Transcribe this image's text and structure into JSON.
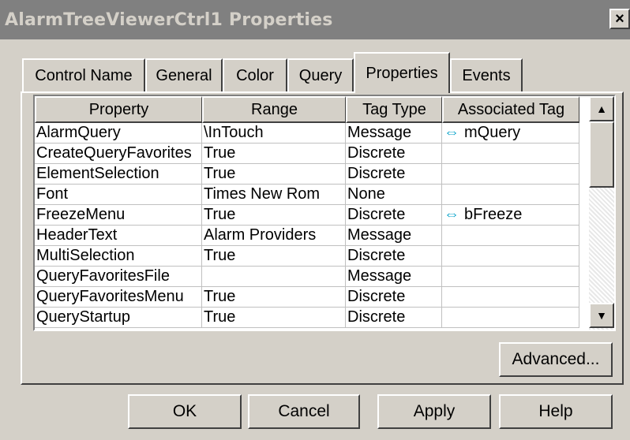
{
  "window": {
    "title": "AlarmTreeViewerCtrl1 Properties",
    "close_label": "×"
  },
  "tabs": [
    {
      "label": "Control Name"
    },
    {
      "label": "General"
    },
    {
      "label": "Color"
    },
    {
      "label": "Query"
    },
    {
      "label": "Properties",
      "active": true
    },
    {
      "label": "Events"
    }
  ],
  "table": {
    "headers": [
      "Property",
      "Range",
      "Tag Type",
      "Associated Tag"
    ],
    "rows": [
      [
        "AlarmQuery",
        "\\InTouch",
        "Message",
        "mQuery"
      ],
      [
        "CreateQueryFavorites",
        "True",
        "Discrete",
        ""
      ],
      [
        "ElementSelection",
        "True",
        "Discrete",
        ""
      ],
      [
        "Font",
        "Times New Rom",
        "None",
        ""
      ],
      [
        "FreezeMenu",
        "True",
        "Discrete",
        "bFreeze"
      ],
      [
        "HeaderText",
        "Alarm Providers",
        "Message",
        ""
      ],
      [
        "MultiSelection",
        "True",
        "Discrete",
        ""
      ],
      [
        "QueryFavoritesFile",
        "",
        "Message",
        ""
      ],
      [
        "QueryFavoritesMenu",
        "True",
        "Discrete",
        ""
      ],
      [
        "QueryStartup",
        "True",
        "Discrete",
        ""
      ]
    ],
    "linked_icon": "bidirectional-arrow-icon"
  },
  "buttons": {
    "advanced": "Advanced...",
    "ok": "OK",
    "cancel": "Cancel",
    "apply": "Apply",
    "help": "Help"
  }
}
